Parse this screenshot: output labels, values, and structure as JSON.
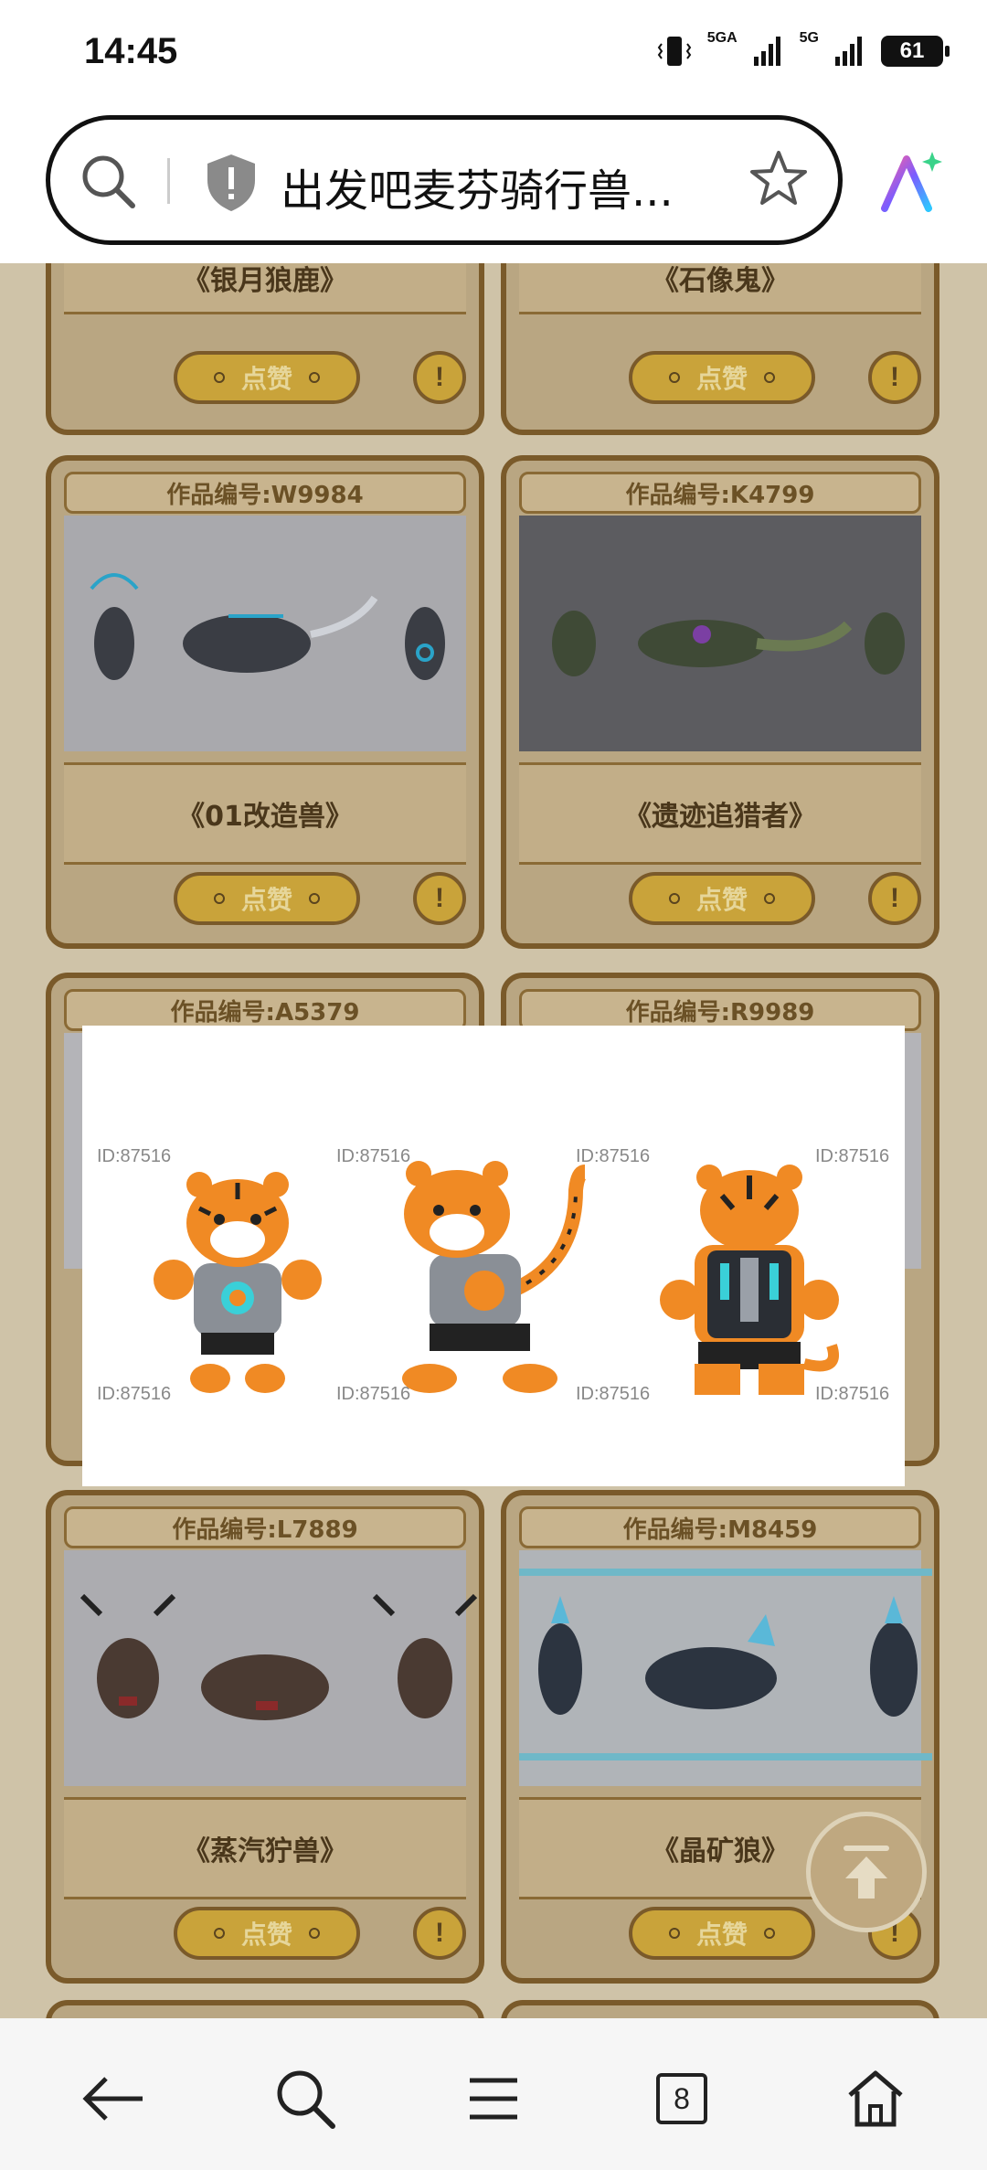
{
  "status_bar": {
    "time": "14:45",
    "signal1_label": "5GA",
    "signal2_label": "5G",
    "battery": "61"
  },
  "address_bar": {
    "title": "出发吧麦芬骑行兽..."
  },
  "cards_top_partial": [
    {
      "title": "《银月狼鹿》",
      "like_label": "点赞"
    },
    {
      "title": "《石像鬼》",
      "like_label": "点赞"
    }
  ],
  "cards_row2": [
    {
      "code": "作品编号:W9984",
      "title": "《01改造兽》",
      "like_label": "点赞"
    },
    {
      "code": "作品编号:K4799",
      "title": "《遗迹追猎者》",
      "like_label": "点赞"
    }
  ],
  "cards_row3": [
    {
      "code": "作品编号:A5379"
    },
    {
      "code": "作品编号:R9989"
    }
  ],
  "cards_row4": [
    {
      "code": "作品编号:L7889",
      "title": "《蒸汽狞兽》",
      "like_label": "点赞"
    },
    {
      "code": "作品编号:M8459",
      "title": "《晶矿狼》",
      "like_label": "点赞"
    }
  ],
  "popup": {
    "watermark": "ID:87516"
  },
  "bottom_nav": {
    "tab_count": "8"
  },
  "colors": {
    "accent_gold": "#c9a33a",
    "frame_brown": "#7a5a2a",
    "tiger_orange": "#f08a24"
  }
}
